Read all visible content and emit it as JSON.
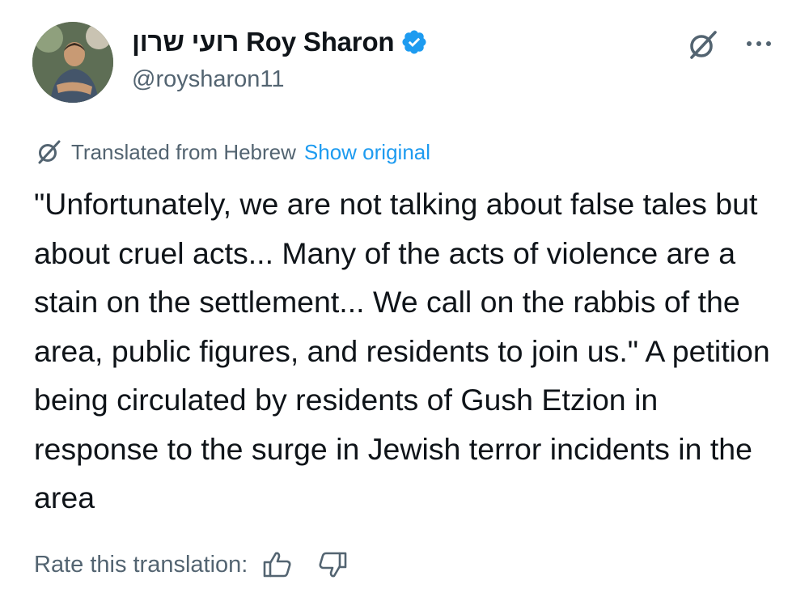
{
  "author": {
    "display_name": "רועי שרון Roy Sharon",
    "handle": "@roysharon11",
    "verified": true,
    "avatar_icon": "profile-photo"
  },
  "header_icons": {
    "grok": "grok-icon",
    "more": "more-options-icon"
  },
  "translation": {
    "label": "Translated from Hebrew",
    "show_original": "Show original"
  },
  "tweet": {
    "text": "\"Unfortunately, we are not talking about false tales but about cruel acts... Many of the acts of violence are a stain on the settlement... We call on the rabbis of the area, public figures, and residents to join us.\" A petition being circulated by residents of Gush Etzion in response to the surge in Jewish terror incidents in the area"
  },
  "rating": {
    "label": "Rate this translation:",
    "thumbs_up_icon": "thumbs-up-icon",
    "thumbs_down_icon": "thumbs-down-icon"
  },
  "colors": {
    "text": "#0f1419",
    "secondary": "#536471",
    "link": "#1d9bf0",
    "verified": "#1d9bf0"
  }
}
